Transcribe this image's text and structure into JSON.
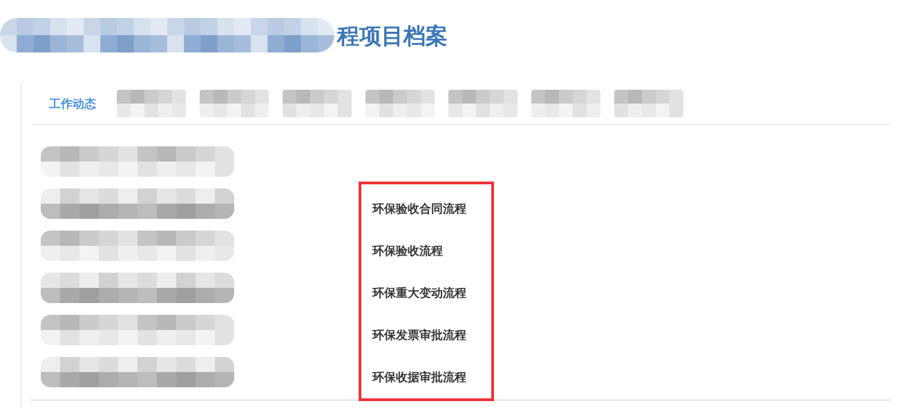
{
  "header": {
    "title": "程项目档案"
  },
  "tabs": [
    {
      "kind": "text",
      "label": "工作动态",
      "selected": true
    },
    {
      "kind": "redacted"
    },
    {
      "kind": "redacted"
    },
    {
      "kind": "redacted"
    },
    {
      "kind": "redacted"
    },
    {
      "kind": "redacted"
    },
    {
      "kind": "redacted"
    },
    {
      "kind": "redacted"
    }
  ],
  "rows": [
    {
      "kind": "redacted"
    },
    {
      "kind": "process",
      "label": "环保验收合同流程"
    },
    {
      "kind": "process",
      "label": "环保验收流程"
    },
    {
      "kind": "process",
      "label": "环保重大变动流程"
    },
    {
      "kind": "process",
      "label": "环保发票审批流程"
    },
    {
      "kind": "process",
      "label": "环保收据审批流程"
    }
  ]
}
